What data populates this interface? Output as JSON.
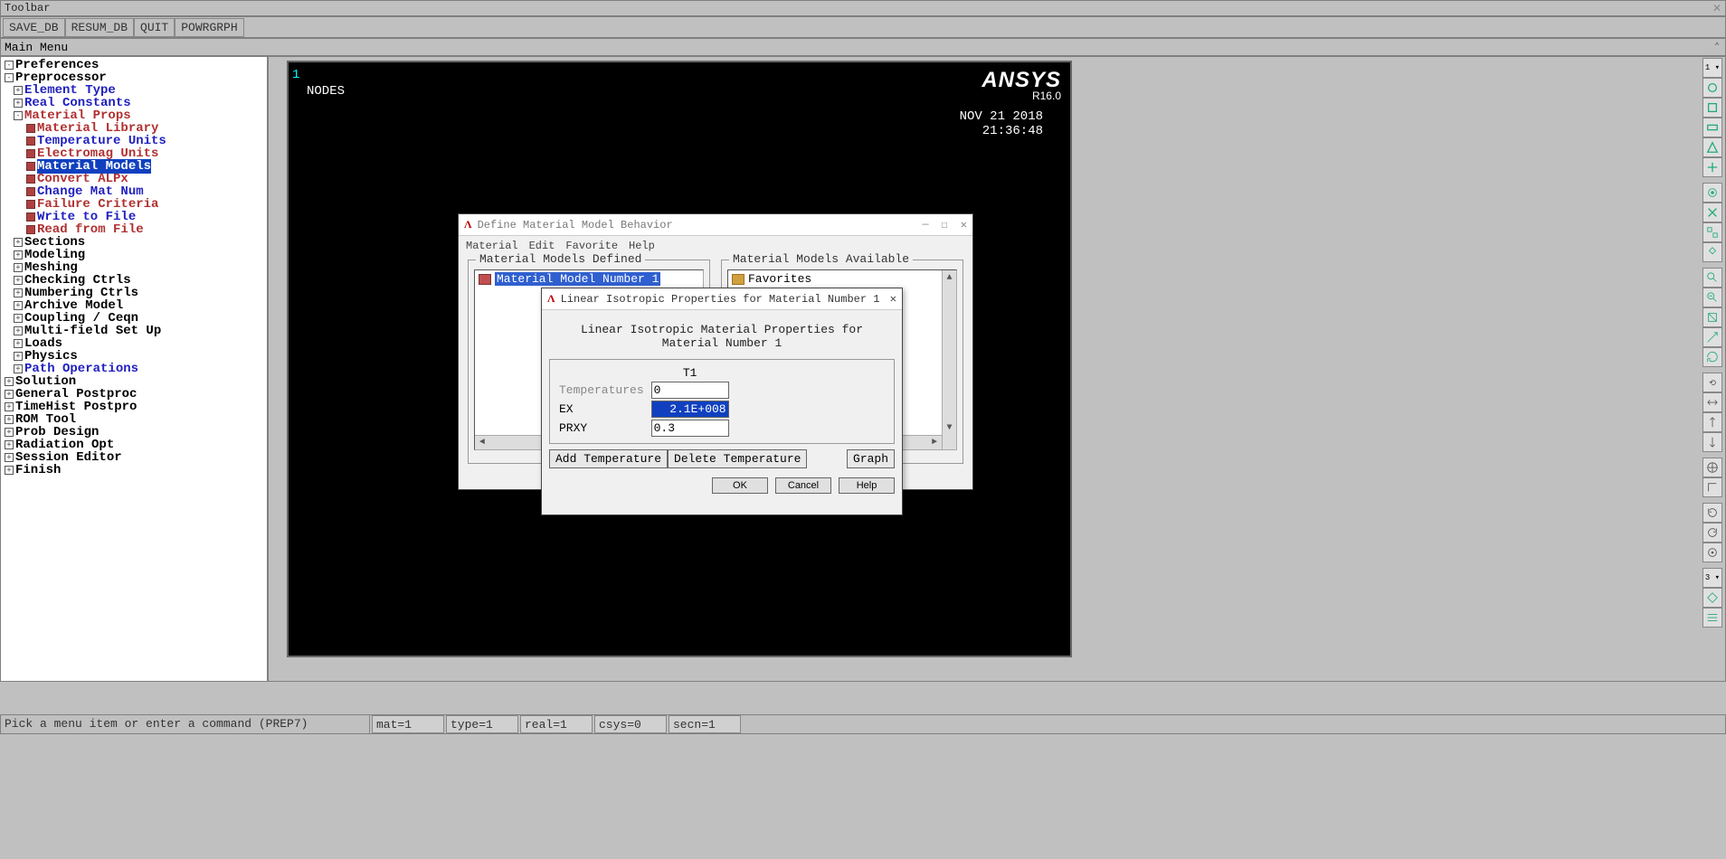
{
  "titlebar": {
    "label": "Toolbar"
  },
  "toolbar": {
    "save_db": "SAVE_DB",
    "resum_db": "RESUM_DB",
    "quit": "QUIT",
    "powrgrph": "POWRGRPH"
  },
  "main_menu_title": "Main Menu",
  "tree": [
    {
      "lvl": 0,
      "exp": "-",
      "cls": "black",
      "label": "Preferences",
      "leaf": false
    },
    {
      "lvl": 0,
      "exp": "-",
      "cls": "black",
      "label": "Preprocessor",
      "leaf": false
    },
    {
      "lvl": 1,
      "exp": "+",
      "cls": "blue",
      "label": "Element Type",
      "leaf": false
    },
    {
      "lvl": 1,
      "exp": "+",
      "cls": "blue",
      "label": "Real Constants",
      "leaf": false
    },
    {
      "lvl": 1,
      "exp": "-",
      "cls": "red",
      "label": "Material Props",
      "leaf": false
    },
    {
      "lvl": 2,
      "exp": "",
      "cls": "red",
      "label": "Material Library",
      "leaf": true
    },
    {
      "lvl": 2,
      "exp": "",
      "cls": "blue",
      "label": "Temperature Units",
      "leaf": true
    },
    {
      "lvl": 2,
      "exp": "",
      "cls": "red",
      "label": "Electromag Units",
      "leaf": true
    },
    {
      "lvl": 2,
      "exp": "",
      "cls": "blue",
      "label": "Material Models",
      "leaf": true,
      "hl": true
    },
    {
      "lvl": 2,
      "exp": "",
      "cls": "red",
      "label": "Convert ALPx",
      "leaf": true
    },
    {
      "lvl": 2,
      "exp": "",
      "cls": "blue",
      "label": "Change Mat Num",
      "leaf": true
    },
    {
      "lvl": 2,
      "exp": "",
      "cls": "red",
      "label": "Failure Criteria",
      "leaf": true
    },
    {
      "lvl": 2,
      "exp": "",
      "cls": "blue",
      "label": "Write to File",
      "leaf": true
    },
    {
      "lvl": 2,
      "exp": "",
      "cls": "red",
      "label": "Read from File",
      "leaf": true
    },
    {
      "lvl": 1,
      "exp": "+",
      "cls": "black",
      "label": "Sections",
      "leaf": false
    },
    {
      "lvl": 1,
      "exp": "+",
      "cls": "black",
      "label": "Modeling",
      "leaf": false
    },
    {
      "lvl": 1,
      "exp": "+",
      "cls": "black",
      "label": "Meshing",
      "leaf": false
    },
    {
      "lvl": 1,
      "exp": "+",
      "cls": "black",
      "label": "Checking Ctrls",
      "leaf": false
    },
    {
      "lvl": 1,
      "exp": "+",
      "cls": "black",
      "label": "Numbering Ctrls",
      "leaf": false
    },
    {
      "lvl": 1,
      "exp": "+",
      "cls": "black",
      "label": "Archive Model",
      "leaf": false
    },
    {
      "lvl": 1,
      "exp": "+",
      "cls": "black",
      "label": "Coupling / Ceqn",
      "leaf": false
    },
    {
      "lvl": 1,
      "exp": "+",
      "cls": "black",
      "label": "Multi-field Set Up",
      "leaf": false
    },
    {
      "lvl": 1,
      "exp": "+",
      "cls": "black",
      "label": "Loads",
      "leaf": false
    },
    {
      "lvl": 1,
      "exp": "+",
      "cls": "black",
      "label": "Physics",
      "leaf": false
    },
    {
      "lvl": 1,
      "exp": "+",
      "cls": "blue",
      "label": "Path Operations",
      "leaf": false
    },
    {
      "lvl": 0,
      "exp": "+",
      "cls": "black",
      "label": "Solution",
      "leaf": false
    },
    {
      "lvl": 0,
      "exp": "+",
      "cls": "black",
      "label": "General Postproc",
      "leaf": false
    },
    {
      "lvl": 0,
      "exp": "+",
      "cls": "black",
      "label": "TimeHist Postpro",
      "leaf": false
    },
    {
      "lvl": 0,
      "exp": "+",
      "cls": "black",
      "label": "ROM Tool",
      "leaf": false
    },
    {
      "lvl": 0,
      "exp": "+",
      "cls": "black",
      "label": "Prob Design",
      "leaf": false
    },
    {
      "lvl": 0,
      "exp": "+",
      "cls": "black",
      "label": "Radiation Opt",
      "leaf": false
    },
    {
      "lvl": 0,
      "exp": "+",
      "cls": "black",
      "label": "Session Editor",
      "leaf": false
    },
    {
      "lvl": 0,
      "exp": "+",
      "cls": "black",
      "label": "Finish",
      "leaf": false
    }
  ],
  "gfx": {
    "index": "1",
    "nodes": "NODES",
    "brand": "ANSYS",
    "version": "R16.0",
    "date": "NOV 21 2018",
    "time": "21:36:48"
  },
  "status": {
    "prompt": "Pick a menu item or enter a command (PREP7)",
    "mat": "mat=1",
    "type": "type=1",
    "real": "real=1",
    "csys": "csys=0",
    "secn": "secn=1"
  },
  "dlg1": {
    "title": "Define Material Model Behavior",
    "menu": {
      "material": "Material",
      "edit": "Edit",
      "favorite": "Favorite",
      "help": "Help"
    },
    "defined_legend": "Material Models Defined",
    "available_legend": "Material Models Available",
    "defined_item": "Material Model Number 1",
    "available_item": "Favorites"
  },
  "dlg2": {
    "title": "Linear Isotropic Properties for Material Number 1",
    "subtitle": "Linear Isotropic Material Properties for Material Number 1",
    "col": "T1",
    "rows": {
      "temps_label": "Temperatures",
      "temps_val": "0",
      "ex_label": "EX",
      "ex_val": "2.1E+008",
      "prxy_label": "PRXY",
      "prxy_val": "0.3"
    },
    "buttons": {
      "add_temp": "Add Temperature",
      "del_temp": "Delete Temperature",
      "graph": "Graph",
      "ok": "OK",
      "cancel": "Cancel",
      "help": "Help"
    }
  },
  "right_marker_top": "1 ▾",
  "right_marker_mid": "3 ▾"
}
